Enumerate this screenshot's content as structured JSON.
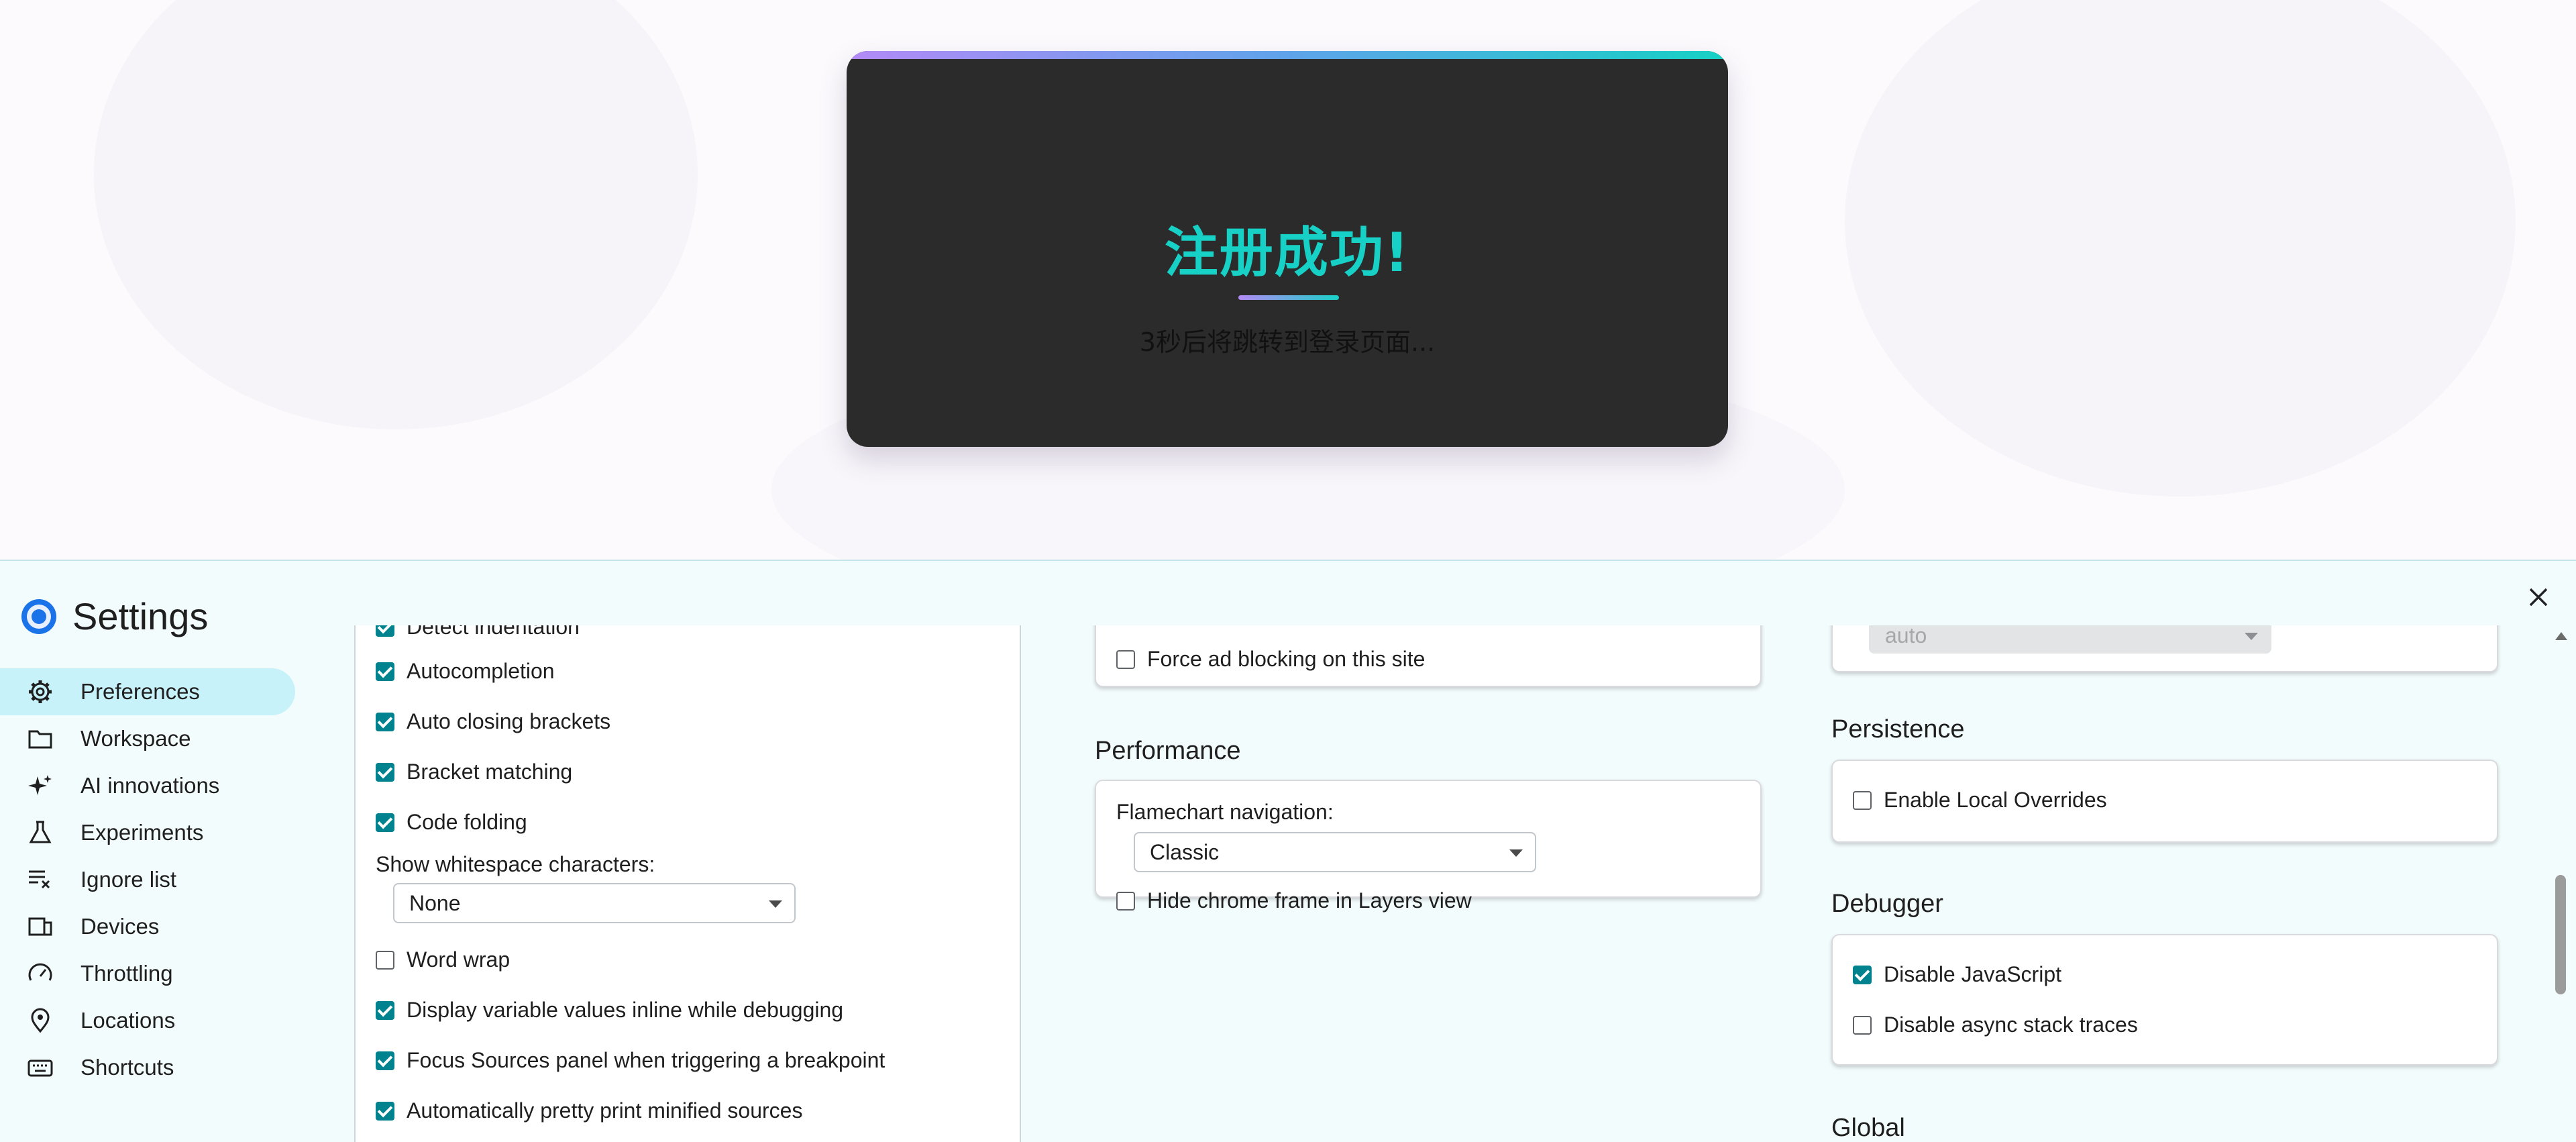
{
  "webpage": {
    "card_title": "注册成功!",
    "card_subtitle": "3秒后将跳转到登录页面...",
    "accent_colors": {
      "title": "#17d0c6",
      "bar_start": "#b38af7",
      "bar_end": "#16d1c4"
    }
  },
  "settings": {
    "title": "Settings",
    "close_icon": "close-icon",
    "nav": [
      {
        "label": "Preferences",
        "icon": "gear-icon",
        "active": true
      },
      {
        "label": "Workspace",
        "icon": "folder-icon"
      },
      {
        "label": "AI innovations",
        "icon": "sparkle-icon"
      },
      {
        "label": "Experiments",
        "icon": "flask-icon"
      },
      {
        "label": "Ignore list",
        "icon": "ignore-list-icon"
      },
      {
        "label": "Devices",
        "icon": "devices-icon"
      },
      {
        "label": "Throttling",
        "icon": "gauge-icon"
      },
      {
        "label": "Locations",
        "icon": "pin-icon"
      },
      {
        "label": "Shortcuts",
        "icon": "keyboard-icon"
      }
    ],
    "sources": {
      "partial_label": "Detect indentation",
      "autocompletion": "Autocompletion",
      "auto_closing": "Auto closing brackets",
      "bracket_matching": "Bracket matching",
      "code_folding": "Code folding",
      "whitespace_label": "Show whitespace characters:",
      "whitespace_value": "None",
      "word_wrap": "Word wrap",
      "inline_values": "Display variable values inline while debugging",
      "focus_sources": "Focus Sources panel when triggering a breakpoint",
      "pretty_print": "Automatically pretty print minified sources"
    },
    "network": {
      "force_ad_blocking": "Force ad blocking on this site"
    },
    "performance": {
      "heading": "Performance",
      "flamechart_label": "Flamechart navigation:",
      "flamechart_value": "Classic",
      "hide_chrome_frame": "Hide chrome frame in Layers view"
    },
    "col3": {
      "disabled_select_value": "auto",
      "persistence_heading": "Persistence",
      "enable_overrides": "Enable Local Overrides",
      "debugger_heading": "Debugger",
      "disable_js": "Disable JavaScript",
      "disable_async": "Disable async stack traces",
      "global_heading": "Global"
    }
  }
}
